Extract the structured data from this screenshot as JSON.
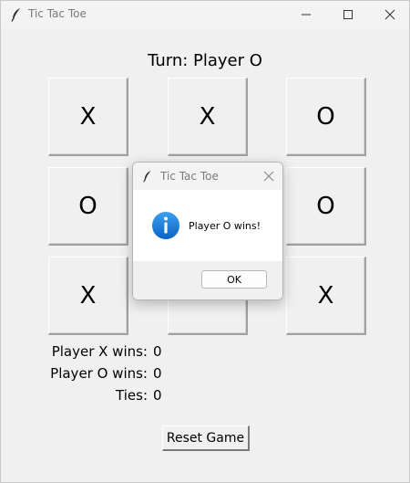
{
  "window": {
    "title": "Tic Tac Toe"
  },
  "status": {
    "turn": "Turn: Player O"
  },
  "board": {
    "cells": [
      "X",
      "X",
      "O",
      "O",
      "",
      "O",
      "X",
      "",
      "X"
    ]
  },
  "scores": {
    "x_label": "Player X wins:",
    "x_value": "0",
    "o_label": "Player O wins:",
    "o_value": "0",
    "ties_label": "Ties:",
    "ties_value": "0"
  },
  "controls": {
    "reset_label": "Reset Game"
  },
  "dialog": {
    "title": "Tic Tac Toe",
    "message": "Player O wins!",
    "ok_label": "OK",
    "icon": "info-icon",
    "accent": "#1a73d9"
  }
}
